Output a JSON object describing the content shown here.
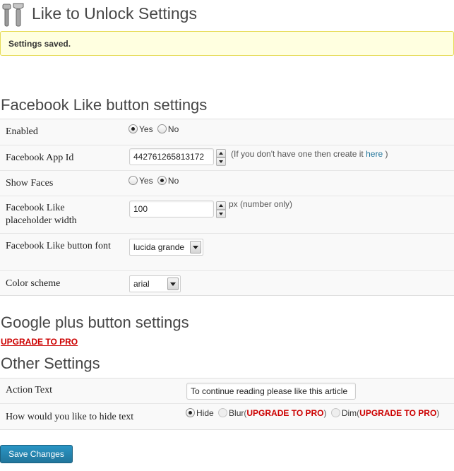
{
  "header": {
    "title": "Like to Unlock Settings",
    "icon": "tools-icon"
  },
  "notice": {
    "text": "Settings saved."
  },
  "facebook": {
    "heading": "Facebook Like button settings",
    "enabled": {
      "label": "Enabled",
      "yes": "Yes",
      "no": "No",
      "selected": "Yes"
    },
    "app_id": {
      "label": "Facebook App Id",
      "value": "442761265813172",
      "help_prefix": "(If you don't have one then create it",
      "help_link": "here",
      "help_suffix": ")"
    },
    "show_faces": {
      "label": "Show Faces",
      "yes": "Yes",
      "no": "No",
      "selected": "No"
    },
    "width": {
      "label": "Facebook Like placeholder width",
      "value": "100",
      "help": "px (number only)"
    },
    "font": {
      "label": "Facebook Like button font",
      "value": "lucida grande"
    },
    "color_scheme": {
      "label": "Color scheme",
      "value": "arial"
    }
  },
  "google": {
    "heading": "Google plus button settings",
    "upgrade": "UPGRADE TO PRO"
  },
  "other": {
    "heading": "Other Settings",
    "action_text": {
      "label": "Action Text",
      "value": "To continue reading please like this article"
    },
    "hide_text": {
      "label": "How would you like to hide text",
      "hide": "Hide",
      "blur": "Blur",
      "dim": "Dim",
      "open_paren": "(",
      "close_paren": ")",
      "upgrade": "UPGRADE TO PRO",
      "selected": "Hide"
    }
  },
  "save_button": "Save Changes",
  "colors": {
    "accent": "#21759b",
    "pro": "#cc0000",
    "notice_bg": "#ffffe0",
    "notice_border": "#e6db55"
  }
}
